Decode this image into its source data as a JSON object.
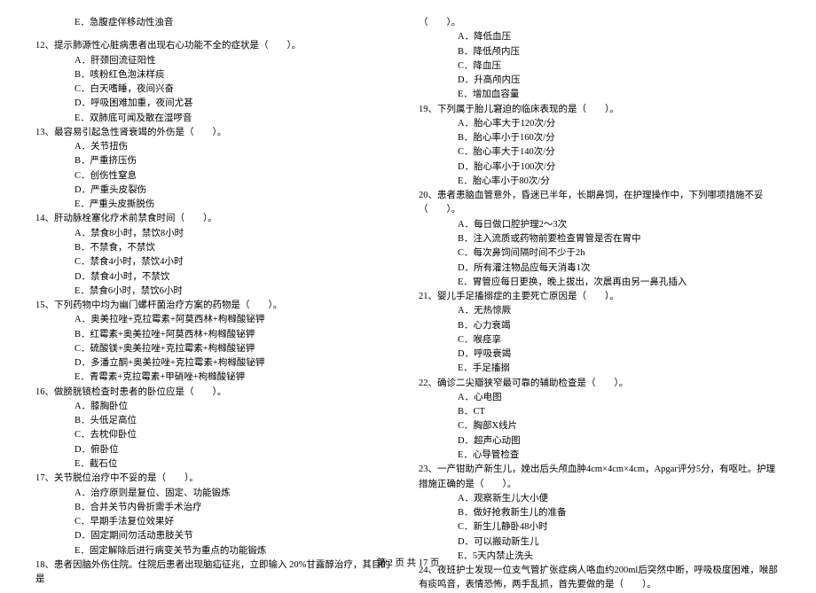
{
  "left": {
    "tail_opt": "E．急腹症伴移动性浊音",
    "q12": {
      "stem": "12、提示肺源性心脏病患者出现右心功能不全的症状是（　　）。",
      "a": "A．肝颈回流征阳性",
      "b": "B．咳粉红色泡沫样痰",
      "c": "C．白天嗜睡，夜间兴奋",
      "d": "D．呼吸困难加重，夜间尤甚",
      "e": "E．双肺底可闻及散在湿啰音"
    },
    "q13": {
      "stem": "13、最容易引起急性肾衰竭的外伤是（　　）。",
      "a": "A．关节扭伤",
      "b": "B．严重挤压伤",
      "c": "C．创伤性窒息",
      "d": "D．严重头皮裂伤",
      "e": "E．严重头皮撕脱伤"
    },
    "q14": {
      "stem": "14、肝动脉栓塞化疗术前禁食时间（　　）。",
      "a": "A．禁食8小时，禁饮8小时",
      "b": "B．不禁食，不禁饮",
      "c": "C．禁食4小时，禁饮4小时",
      "d": "D．禁食4小时，不禁饮",
      "e": "E．禁食6小时，禁饮6小时"
    },
    "q15": {
      "stem": "15、下列药物中均为幽门螺杆菌治疗方案的药物是（　　）。",
      "a": "A．奥美拉唑+克拉霉素+阿莫西林+枸橼酸铋钾",
      "b": "B．红霉素+奥美拉唑+阿莫西林+枸橼酸铋钾",
      "c": "C．硫酸镁+奥美拉唑+克拉霉素+枸橼酸铋钾",
      "d": "D．多潘立酮+奥美拉唑+克拉霉素+枸橼酸铋钾",
      "e": "E．青霉素+克拉霉素+甲硝唑+枸橼酸铋钾"
    },
    "q16": {
      "stem": "16、做膀胱镜检查时患者的卧位应是（　　）。",
      "a": "A．膝胸卧位",
      "b": "B．头低足高位",
      "c": "C．去枕仰卧位",
      "d": "D．俯卧位",
      "e": "E．截石位"
    },
    "q17": {
      "stem": "17、关节脱位治疗中不妥的是（　　）。",
      "a": "A．治疗原则是复位、固定、功能锻炼",
      "b": "B．合并关节内骨折需手术治疗",
      "c": "C．早期手法复位效果好",
      "d": "D．固定期间勿活动患肢关节",
      "e": "E．固定解除后进行病变关节为重点的功能锻炼"
    },
    "q18": {
      "stem": "18、患者因脑外伤住院。住院后患者出现脑疝征兆，立即输入 20%甘露醇治疗，其目的是"
    }
  },
  "right": {
    "q18_cont": "（　　）。",
    "q18": {
      "a": "A．降低血压",
      "b": "B．降低颅内压",
      "c": "C．降血压",
      "d": "D．升高颅内压",
      "e": "E．增加血容量"
    },
    "q19": {
      "stem": "19、下列属于胎儿窘迫的临床表现的是（　　）。",
      "a": "A．胎心率大于120次/分",
      "b": "B．胎心率小于160次/分",
      "c": "C．胎心率大于140次/分",
      "d": "D．胎心率小于100次/分",
      "e": "E．胎心率小于80次/分"
    },
    "q20": {
      "stem": "20、患者患脑血管意外，昏迷已半年，长期鼻饲，在护理操作中，下列哪项措施不妥（　　）。",
      "a": "A．每日做口腔护理2～3次",
      "b": "B．注入流质或药物前要检查胃管是否在胃中",
      "c": "C．每次鼻饲间隔时间不少于2h",
      "d": "D．所有灌注物品应每天消毒1次",
      "e": "E．胃管应每日更换，晚上拔出，次晨再由另一鼻孔插入"
    },
    "q21": {
      "stem": "21、婴儿手足搐搦症的主要死亡原因是（　　）。",
      "a": "A．无热惊厥",
      "b": "B．心力衰竭",
      "c": "C．喉痉挛",
      "d": "D．呼吸衰竭",
      "e": "E．手足搐搦"
    },
    "q22": {
      "stem": "22、确诊二尖瓣狭窄最可靠的辅助检查是（　　）。",
      "a": "A．心电图",
      "b": "B．CT",
      "c": "C．胸部X线片",
      "d": "D．超声心动图",
      "e": "E．心导管检查"
    },
    "q23": {
      "stem": "23、一产钳助产新生儿，娩出后头颅血肿4cm×4cm×4cm，Apgar评分5分，有呕吐。护理措施正确的是（　　）。",
      "a": "A．观察新生儿大小便",
      "b": "B．做好抢救新生儿的准备",
      "c": "C．新生儿静卧48小时",
      "d": "D．可以搬动新生儿",
      "e": "E．5天内禁止洗头"
    },
    "q24": {
      "stem": "24、夜班护士发现一位支气管扩张症病人咯血约200ml后突然中断，呼吸极度困难，喉部有痰鸣音，表情恐怖，两手乱抓，首先要做的是（　　）。"
    }
  },
  "footer": "第 2 页 共 17 页"
}
